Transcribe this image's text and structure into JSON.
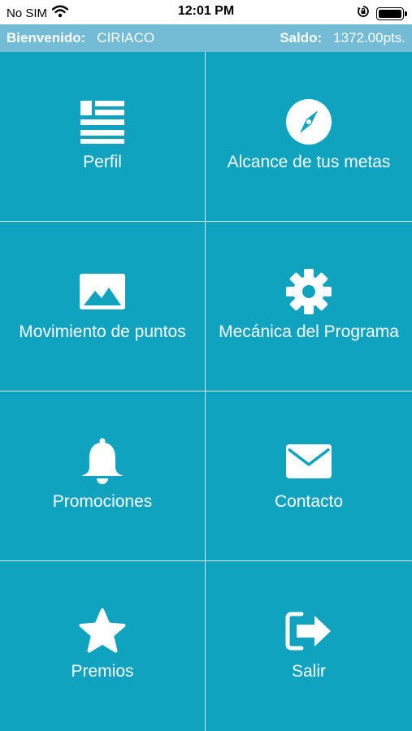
{
  "status_bar": {
    "carrier": "No SIM",
    "time": "12:01 PM"
  },
  "info_bar": {
    "welcome_label": "Bienvenido:",
    "user_name": "CIRIACO",
    "balance_label": "Saldo:",
    "balance_value": "1372.00pts."
  },
  "menu": [
    {
      "label": "Perfil",
      "icon": "profile-icon"
    },
    {
      "label": "Alcance de tus metas",
      "icon": "compass-icon"
    },
    {
      "label": "Movimiento de puntos",
      "icon": "image-icon"
    },
    {
      "label": "Mecánica del Programa",
      "icon": "gear-icon"
    },
    {
      "label": "Promociones",
      "icon": "bell-icon"
    },
    {
      "label": "Contacto",
      "icon": "envelope-icon"
    },
    {
      "label": "Premios",
      "icon": "star-icon"
    },
    {
      "label": "Salir",
      "icon": "logout-icon"
    }
  ],
  "colors": {
    "tile_background": "#0fa3bf",
    "info_bar_background": "#74bcd6",
    "foreground": "#ffffff"
  }
}
